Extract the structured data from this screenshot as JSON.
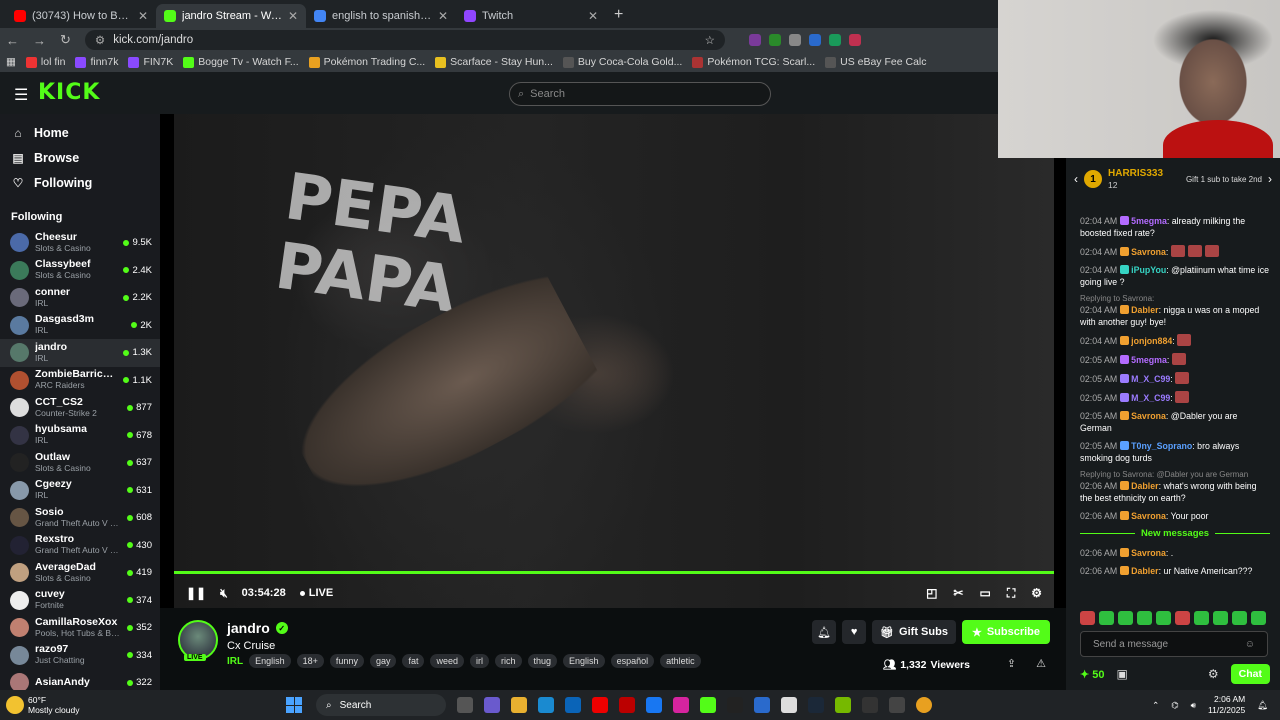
{
  "browser": {
    "tabs": [
      {
        "title": "(30743) How to BLOCK ADS On",
        "color": "#ff0000",
        "active": false
      },
      {
        "title": "jandro Stream - Watch Live",
        "color": "#53fc18",
        "active": true
      },
      {
        "title": "english to spanish - Google Se",
        "color": "#4285f4",
        "active": false
      },
      {
        "title": "Twitch",
        "color": "#9146ff",
        "active": false
      }
    ],
    "url": "kick.com/jandro",
    "bookmarks": [
      "lol fin",
      "finn7k",
      "FIN7K",
      "Bogge Tv - Watch F...",
      "Pokémon Trading C...",
      "Scarface - Stay Hun...",
      "Buy Coca-Cola Gold...",
      "Pokémon TCG: Scarl...",
      "US eBay Fee Calc"
    ]
  },
  "kick": {
    "logo": "KICK",
    "search_placeholder": "Search",
    "nav": [
      {
        "label": "Home",
        "icon": "⌂"
      },
      {
        "label": "Browse",
        "icon": "▤"
      },
      {
        "label": "Following",
        "icon": "♡"
      }
    ],
    "following_header": "Following",
    "channels": [
      {
        "name": "Cheesur",
        "category": "Slots & Casino",
        "viewers": "9.5K",
        "color": "#4b6aa8"
      },
      {
        "name": "Classybeef",
        "category": "Slots & Casino",
        "viewers": "2.4K",
        "color": "#3b7a5a"
      },
      {
        "name": "conner",
        "category": "IRL",
        "viewers": "2.2K",
        "color": "#6a6a7a"
      },
      {
        "name": "Dasgasd3m",
        "category": "IRL",
        "viewers": "2K",
        "color": "#5a7aa0"
      },
      {
        "name": "jandro",
        "category": "IRL",
        "viewers": "1.3K",
        "color": "#56786a"
      },
      {
        "name": "ZombieBarricades",
        "category": "ARC Raiders",
        "viewers": "1.1K",
        "color": "#b05030"
      },
      {
        "name": "CCT_CS2",
        "category": "Counter-Strike 2",
        "viewers": "877",
        "color": "#ddd"
      },
      {
        "name": "hyubsama",
        "category": "IRL",
        "viewers": "678",
        "color": "#334"
      },
      {
        "name": "Outlaw",
        "category": "Slots & Casino",
        "viewers": "637",
        "color": "#222"
      },
      {
        "name": "Cgeezy",
        "category": "IRL",
        "viewers": "631",
        "color": "#8899aa"
      },
      {
        "name": "Sosio",
        "category": "Grand Theft Auto V (G...",
        "viewers": "608",
        "color": "#654"
      },
      {
        "name": "Rexstro",
        "category": "Grand Theft Auto V (G...",
        "viewers": "430",
        "color": "#223"
      },
      {
        "name": "AverageDad",
        "category": "Slots & Casino",
        "viewers": "419",
        "color": "#c0a080"
      },
      {
        "name": "cuvey",
        "category": "Fortnite",
        "viewers": "374",
        "color": "#eee"
      },
      {
        "name": "CamillaRoseXox",
        "category": "Pools, Hot Tubs & Biki...",
        "viewers": "352",
        "color": "#c08070"
      },
      {
        "name": "razo97",
        "category": "Just Chatting",
        "viewers": "334",
        "color": "#789"
      },
      {
        "name": "AsianAndy",
        "category": "",
        "viewers": "322",
        "color": "#a77"
      }
    ]
  },
  "player": {
    "time": "03:54:28",
    "live_label": "LIVE",
    "progress": 1.0
  },
  "stream": {
    "channel": "jandro",
    "title": "Cx Cruise",
    "live_tag": "LIVE",
    "category": "IRL",
    "tags": [
      "English",
      "18+",
      "funny",
      "gay",
      "fat",
      "weed",
      "irl",
      "rich",
      "thug",
      "English",
      "español",
      "athletic"
    ],
    "gift_label": "Gift Subs",
    "subscribe_label": "Subscribe",
    "viewers": "1,332",
    "viewers_label": "Viewers"
  },
  "chat": {
    "pinned": {
      "rank": "1",
      "name": "HARRIS333",
      "count": "12",
      "message": "Gift 1 sub to take 2nd"
    },
    "messages": [
      {
        "time": "02:04 AM",
        "user": "5megma",
        "color": "#b36bff",
        "text": "already milking the boosted fixed rate?",
        "reply": ""
      },
      {
        "time": "02:04 AM",
        "user": "Savrona",
        "color": "#f0a030",
        "text": "",
        "reply": "",
        "emotes": 3
      },
      {
        "time": "02:04 AM",
        "user": "iPupYou",
        "color": "#36d4c4",
        "text": "@platiinum what time ice going live ?",
        "reply": ""
      },
      {
        "time": "02:04 AM",
        "user": "Dabler",
        "color": "#f0a030",
        "text": "nigga u was on a moped with another guy! bye!",
        "reply": "Replying to Savrona:"
      },
      {
        "time": "02:04 AM",
        "user": "jonjon884",
        "color": "#f0a030",
        "text": "",
        "reply": "",
        "emotes": 1
      },
      {
        "time": "02:05 AM",
        "user": "5megma",
        "color": "#b36bff",
        "text": "",
        "reply": "",
        "emotes": 1
      },
      {
        "time": "02:05 AM",
        "user": "M_X_C99",
        "color": "#9b7bff",
        "text": "",
        "reply": "",
        "emotes": 1
      },
      {
        "time": "02:05 AM",
        "user": "M_X_C99",
        "color": "#9b7bff",
        "text": "",
        "reply": "",
        "emotes": 1
      },
      {
        "time": "02:05 AM",
        "user": "Savrona",
        "color": "#f0a030",
        "text": "@Dabler you are German",
        "reply": ""
      },
      {
        "time": "02:05 AM",
        "user": "T0ny_Soprano",
        "color": "#5aa0ff",
        "text": "bro always smoking dog turds",
        "reply": ""
      },
      {
        "time": "02:06 AM",
        "user": "Dabler",
        "color": "#f0a030",
        "text": "what's wrong with being the best ethnicity on earth?",
        "reply": "Replying to Savrona: @Dabler you are German"
      },
      {
        "time": "02:06 AM",
        "user": "Savrona",
        "color": "#f0a030",
        "text": "Your poor",
        "reply": ""
      }
    ],
    "new_messages_label": "New messages",
    "new_messages": [
      {
        "time": "02:06 AM",
        "user": "Savrona",
        "color": "#f0a030",
        "text": ".",
        "reply": ""
      },
      {
        "time": "02:06 AM",
        "user": "Dabler",
        "color": "#f0a030",
        "text": "ur Native American???",
        "reply": ""
      }
    ],
    "input_placeholder": "Send a message",
    "points": "50",
    "chat_button": "Chat"
  },
  "taskbar": {
    "temp": "60°F",
    "weather": "Mostly cloudy",
    "search": "Search",
    "time": "2:06 AM",
    "date": "11/2/2025"
  }
}
